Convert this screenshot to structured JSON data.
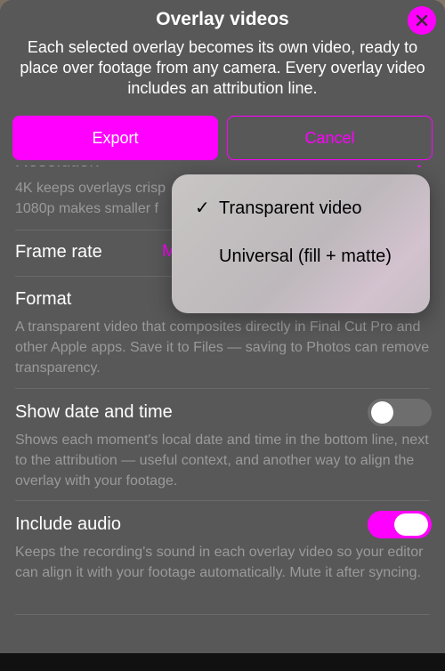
{
  "sheet": {
    "title": "Overlay videos",
    "subtitle": "Each selected overlay becomes its own video, ready to place over footage from any camera. Every overlay video includes an attribution line.",
    "export_label": "Export",
    "cancel_label": "Cancel"
  },
  "resolution": {
    "title": "Resolution",
    "description": "4K keeps overlays crisp\n1080p makes smaller f"
  },
  "frame_rate": {
    "title": "Frame rate",
    "value": "M"
  },
  "format": {
    "title": "Format",
    "description": "A transparent video that composites directly in Final Cut Pro and other Apple apps. Save it to Files — saving to Photos can remove transparency.",
    "options": [
      {
        "label": "Transparent video",
        "selected": true
      },
      {
        "label": "Universal (fill + matte)",
        "selected": false
      }
    ]
  },
  "date_time": {
    "title": "Show date and time",
    "description": "Shows each moment's local date and time in the bottom line, next to the attribution — useful context, and another way to align the overlay with your footage.",
    "enabled": false
  },
  "audio": {
    "title": "Include audio",
    "description": "Keeps the recording's sound in each overlay video so your editor can align it with your footage automatically. Mute it after syncing.",
    "enabled": true
  },
  "popover": {
    "check_glyph": "✓"
  },
  "colors": {
    "accent": "#ff00ff",
    "sheet_background": "#585858",
    "secondary_text": "#9a9a9a"
  }
}
